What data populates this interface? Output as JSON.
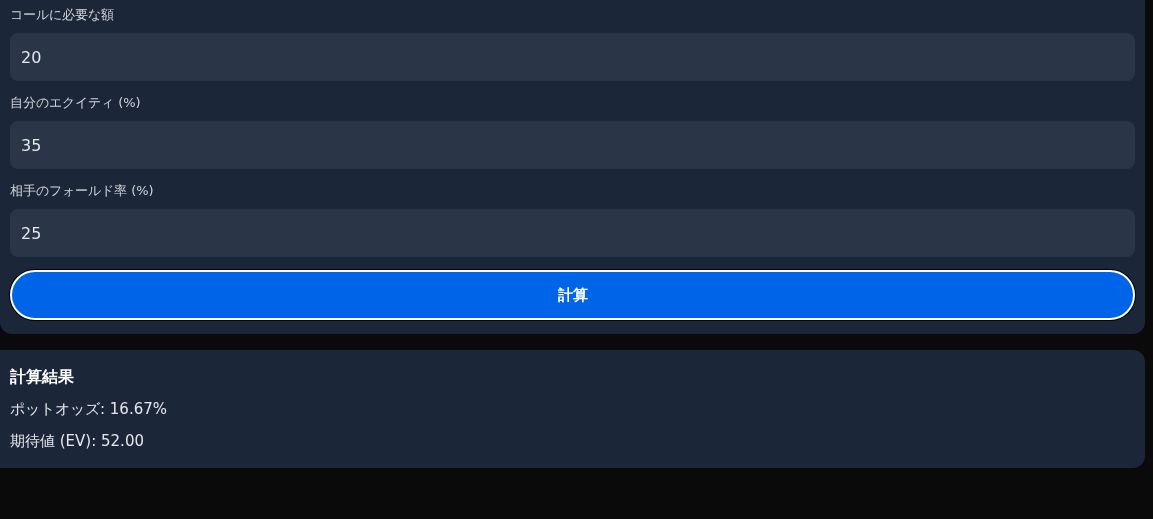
{
  "form": {
    "fields": [
      {
        "label": "コールに必要な額",
        "value": "20"
      },
      {
        "label": "自分のエクイティ (%)",
        "value": "35"
      },
      {
        "label": "相手のフォールド率 (%)",
        "value": "25"
      }
    ],
    "button": "計算"
  },
  "result": {
    "title": "計算結果",
    "lines": [
      "ポットオッズ: 16.67%",
      "期待値 (EV): 52.00"
    ]
  }
}
